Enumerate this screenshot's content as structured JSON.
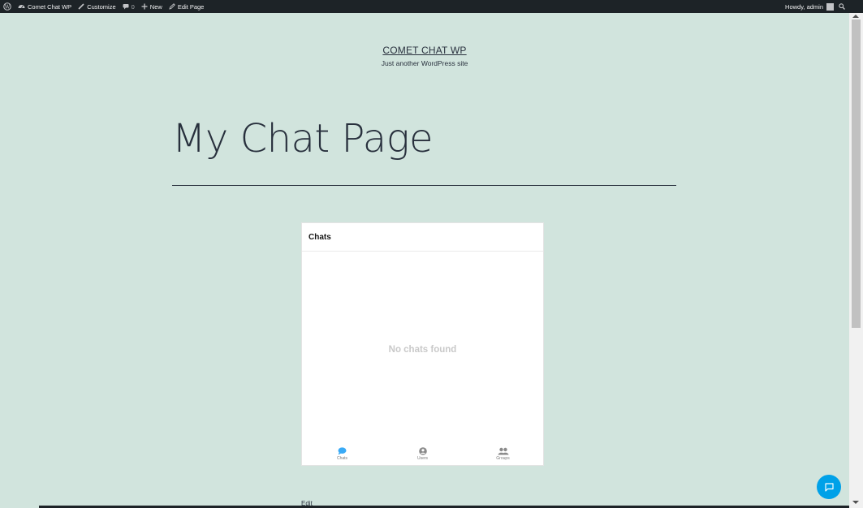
{
  "admin_bar": {
    "site_name": "Comet Chat WP",
    "customize": "Customize",
    "comments_count": "0",
    "new": "New",
    "edit_page": "Edit Page",
    "howdy": "Howdy, admin"
  },
  "site": {
    "title": "COMET CHAT WP",
    "description": "Just another WordPress site"
  },
  "page": {
    "title": "My Chat Page",
    "edit_link": "Edit"
  },
  "chat_widget": {
    "header": "Chats",
    "empty_message": "No chats found",
    "tabs": [
      {
        "label": "Chats",
        "icon": "chat-bubble-icon",
        "active": true
      },
      {
        "label": "Users",
        "icon": "user-circle-icon",
        "active": false
      },
      {
        "label": "Groups",
        "icon": "groups-icon",
        "active": false
      }
    ]
  },
  "colors": {
    "background": "#d1e4dd",
    "admin_bar": "#1d2327",
    "accent": "#00a1e8",
    "active_tab": "#39aaf6"
  }
}
